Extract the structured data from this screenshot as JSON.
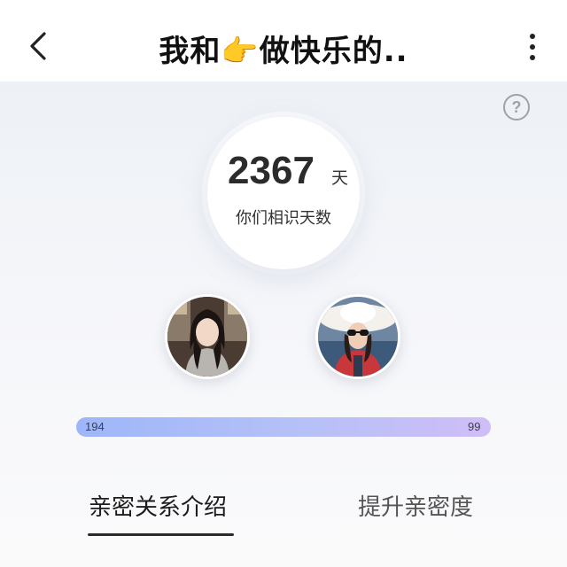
{
  "header": {
    "back_icon": "chevron-left-icon",
    "title": "我和👉做快乐的..",
    "more_icon": "more-vertical-icon"
  },
  "help": {
    "icon": "question-circle-icon",
    "label": "?"
  },
  "stats": {
    "days": "2367",
    "unit": "天",
    "caption": "你们相识天数"
  },
  "progress": {
    "left_value": "194",
    "right_value": "99"
  },
  "tabs": [
    {
      "label": "亲密关系介绍",
      "active": true
    },
    {
      "label": "提升亲密度",
      "active": false
    }
  ],
  "colors": {
    "progress_start": "#9eb6f9",
    "progress_end": "#d0bdf7",
    "background": "#f6f8fb"
  }
}
